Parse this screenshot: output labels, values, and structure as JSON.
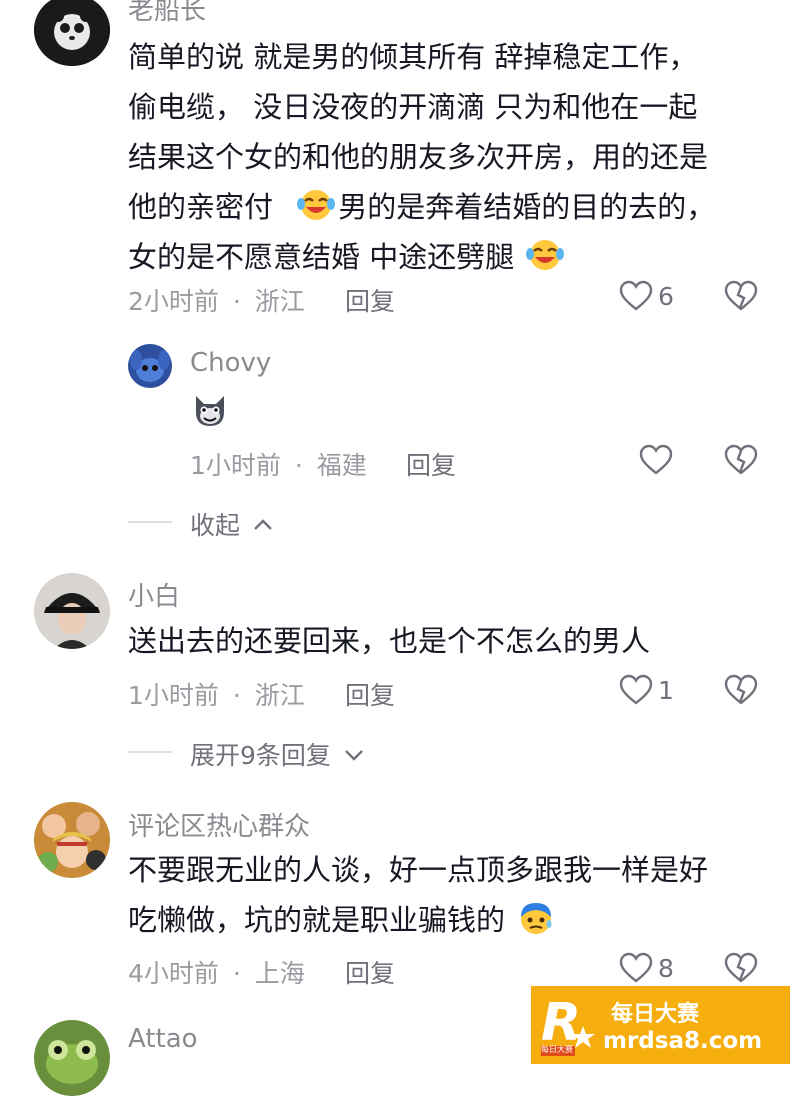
{
  "comments": [
    {
      "username": "老船长",
      "lines": [
        "简单的说  就是男的倾其所有  辞掉稳定工作，",
        "偷电缆，  没日没夜的开滴滴   只为和他在一起",
        "结果这个女的和他的朋友多次开房，用的还是",
        "他的亲密付",
        "男的是奔着结婚的目的去的，",
        "女的是不愿意结婚    中途还劈腿"
      ],
      "time": "2小时前",
      "location": "浙江",
      "reply_label": "回复",
      "likes": "6"
    },
    {
      "username": "Chovy",
      "emoji_icon": "wolf-face-emoji",
      "time": "1小时前",
      "location": "福建",
      "reply_label": "回复",
      "likes": ""
    },
    {
      "username": "小白",
      "lines": [
        "送出去的还要回来，也是个不怎么的男人"
      ],
      "time": "1小时前",
      "location": "浙江",
      "reply_label": "回复",
      "likes": "1"
    },
    {
      "username": "评论区热心群众",
      "lines": [
        "不要跟无业的人谈，好一点顶多跟我一样是好",
        "吃懒做，坑的就是职业骗钱的"
      ],
      "time": "4小时前",
      "location": "上海",
      "reply_label": "回复",
      "likes": "8"
    },
    {
      "username": "Attao"
    }
  ],
  "collapse_label": "收起",
  "expand_label": "展开9条回复",
  "separator": "·",
  "watermark": {
    "title": "每日大赛",
    "url": "mrdsa8.com",
    "badge": "每日大赛"
  },
  "colors": {
    "text": "#161823",
    "muted": "#8a8b91",
    "watermark_bg": "#f6ad0e"
  }
}
